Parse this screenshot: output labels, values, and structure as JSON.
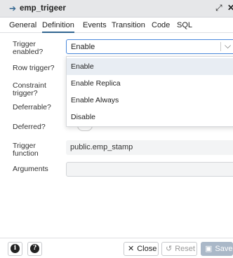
{
  "dialog": {
    "title": "emp_trigeer"
  },
  "tabs": [
    {
      "label": "General"
    },
    {
      "label": "Definition"
    },
    {
      "label": "Events"
    },
    {
      "label": "Transition"
    },
    {
      "label": "Code"
    },
    {
      "label": "SQL"
    }
  ],
  "form": {
    "trigger_enabled_label": "Trigger enabled?",
    "row_trigger_label": "Row trigger?",
    "constraint_trigger_label": "Constraint trigger?",
    "deferrable_label": "Deferrable?",
    "deferred_label": "Deferred?",
    "trigger_function_label": "Trigger function",
    "arguments_label": "Arguments",
    "trigger_enabled_value": "Enable",
    "trigger_function_value": "public.emp_stamp",
    "arguments_value": ""
  },
  "dropdown": {
    "options": [
      "Enable",
      "Enable Replica",
      "Enable Always",
      "Disable"
    ],
    "selected": "Enable"
  },
  "footer": {
    "info_icon": "info-icon",
    "help_icon": "help-icon",
    "close_label": "Close",
    "reset_label": "Reset",
    "save_label": "Save"
  },
  "colors": {
    "accent": "#326690",
    "focus_border": "#4a89dc",
    "save_disabled": "#aab8c8"
  }
}
